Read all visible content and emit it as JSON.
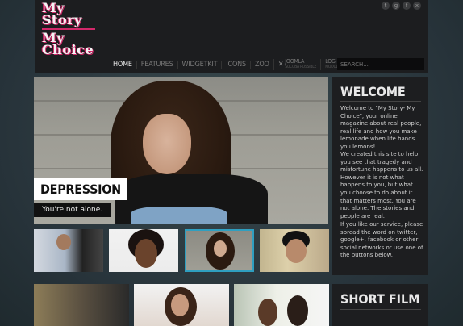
{
  "logo": {
    "line1": "My",
    "line2": "Story",
    "line3": "My",
    "line4": "Choice"
  },
  "social": [
    {
      "icon": "twitter-icon",
      "glyph": "t"
    },
    {
      "icon": "google-plus-icon",
      "glyph": "g"
    },
    {
      "icon": "facebook-icon",
      "glyph": "f"
    },
    {
      "icon": "x-icon",
      "glyph": "x"
    }
  ],
  "nav": {
    "home": "Home",
    "features": "Features",
    "widgetkit": "Widgetkit",
    "icons": "Icons",
    "zoo": "Zoo",
    "joomla_label": "Joomla",
    "joomla_sub": "Sucuba Possible",
    "login_label": "Login",
    "login_sub": "Module Position"
  },
  "search": {
    "placeholder": "SEARCH..."
  },
  "hero": {
    "title": "DEPRESSION",
    "subtitle": "You're not alone."
  },
  "welcome": {
    "title": "WELCOME",
    "p1": "Welcome to \"My Story- My Choice\", your online magazine about real people, real life and how you make lemonade when life hands you lemons!",
    "p2": "We created this site to help you see that tragedy and misfortune happens to us all. However it is not what happens to you, but what you choose to do about it that matters most. You are not alone.  The stories and people are real.",
    "p3": "If you like our service, please spread the word on twitter, google+, facebook or other social networks or use one of the buttons below."
  },
  "shortfilm": {
    "title": "SHORT FILM"
  },
  "colors": {
    "accent": "#d2286a",
    "active_border": "#2f9fc0"
  }
}
